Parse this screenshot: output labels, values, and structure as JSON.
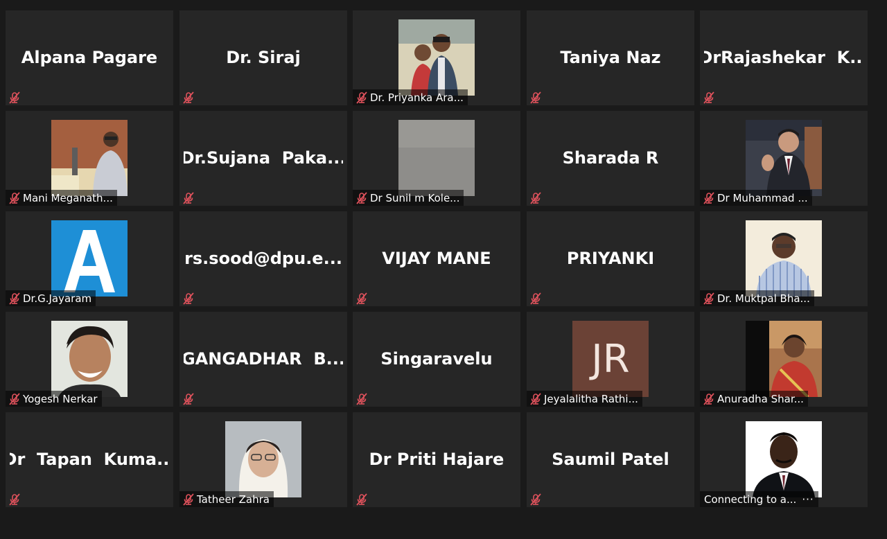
{
  "meeting": {
    "participants": [
      {
        "name": "Alpana Pagare",
        "display": "big",
        "label": ""
      },
      {
        "name": "Dr. Siraj",
        "display": "big",
        "label": ""
      },
      {
        "name": "Dr. Priyanka Ara...",
        "display": "photo",
        "photo": "couple",
        "label": "Dr. Priyanka Ara..."
      },
      {
        "name": "Taniya Naz",
        "display": "big",
        "label": ""
      },
      {
        "name": "DrRajashekar  K...",
        "display": "big",
        "label": ""
      },
      {
        "name": "Mani Meganath...",
        "display": "photo",
        "photo": "speaker",
        "label": "Mani Meganath..."
      },
      {
        "name": "Dr.Sujana  Paka...",
        "display": "big",
        "label": ""
      },
      {
        "name": "Dr Sunil m Kole...",
        "display": "photo",
        "photo": "gray",
        "label": "Dr Sunil m Kole..."
      },
      {
        "name": "Sharada R",
        "display": "big",
        "label": ""
      },
      {
        "name": "Dr Muhammad ...",
        "display": "photo",
        "photo": "suit",
        "label": "Dr Muhammad ..."
      },
      {
        "name": "Dr.G.Jayaram",
        "display": "photo",
        "photo": "letterA",
        "label": "Dr.G.Jayaram"
      },
      {
        "name": "rs.sood@dpu.e...",
        "display": "big",
        "label": ""
      },
      {
        "name": "VIJAY MANE",
        "display": "big",
        "label": ""
      },
      {
        "name": "PRIYANKI",
        "display": "big",
        "label": ""
      },
      {
        "name": "Dr. Muktpal Bha...",
        "display": "photo",
        "photo": "check",
        "label": "Dr. Muktpal Bha..."
      },
      {
        "name": "Yogesh Nerkar",
        "display": "photo",
        "photo": "smile",
        "label": "Yogesh Nerkar"
      },
      {
        "name": "GANGADHAR  B...",
        "display": "big",
        "label": ""
      },
      {
        "name": "Singaravelu",
        "display": "big",
        "label": ""
      },
      {
        "name": "Jeyalalitha Rathi...",
        "display": "photo",
        "photo": "initials",
        "initials": "JR",
        "label": "Jeyalalitha Rathi..."
      },
      {
        "name": "Anuradha Shar...",
        "display": "photo",
        "photo": "saree",
        "label": "Anuradha Shar..."
      },
      {
        "name": "Dr  Tapan  Kuma...",
        "display": "big",
        "label": ""
      },
      {
        "name": "Tatheer Zahra",
        "display": "photo",
        "photo": "scarf",
        "label": "Tatheer Zahra"
      },
      {
        "name": "Dr Priti Hajare",
        "display": "big",
        "label": ""
      },
      {
        "name": "Saumil Patel",
        "display": "big",
        "label": ""
      },
      {
        "name": "Connecting to a...",
        "display": "photo",
        "photo": "formal",
        "label": "Connecting to a...",
        "connecting": true
      }
    ]
  },
  "icons": {
    "muted_mic": "muted-mic-icon",
    "connecting": "loading-dots-icon"
  },
  "colors": {
    "tile_bg": "#262626",
    "page_bg": "#1a1a1a",
    "mute_red": "#e0525c"
  }
}
